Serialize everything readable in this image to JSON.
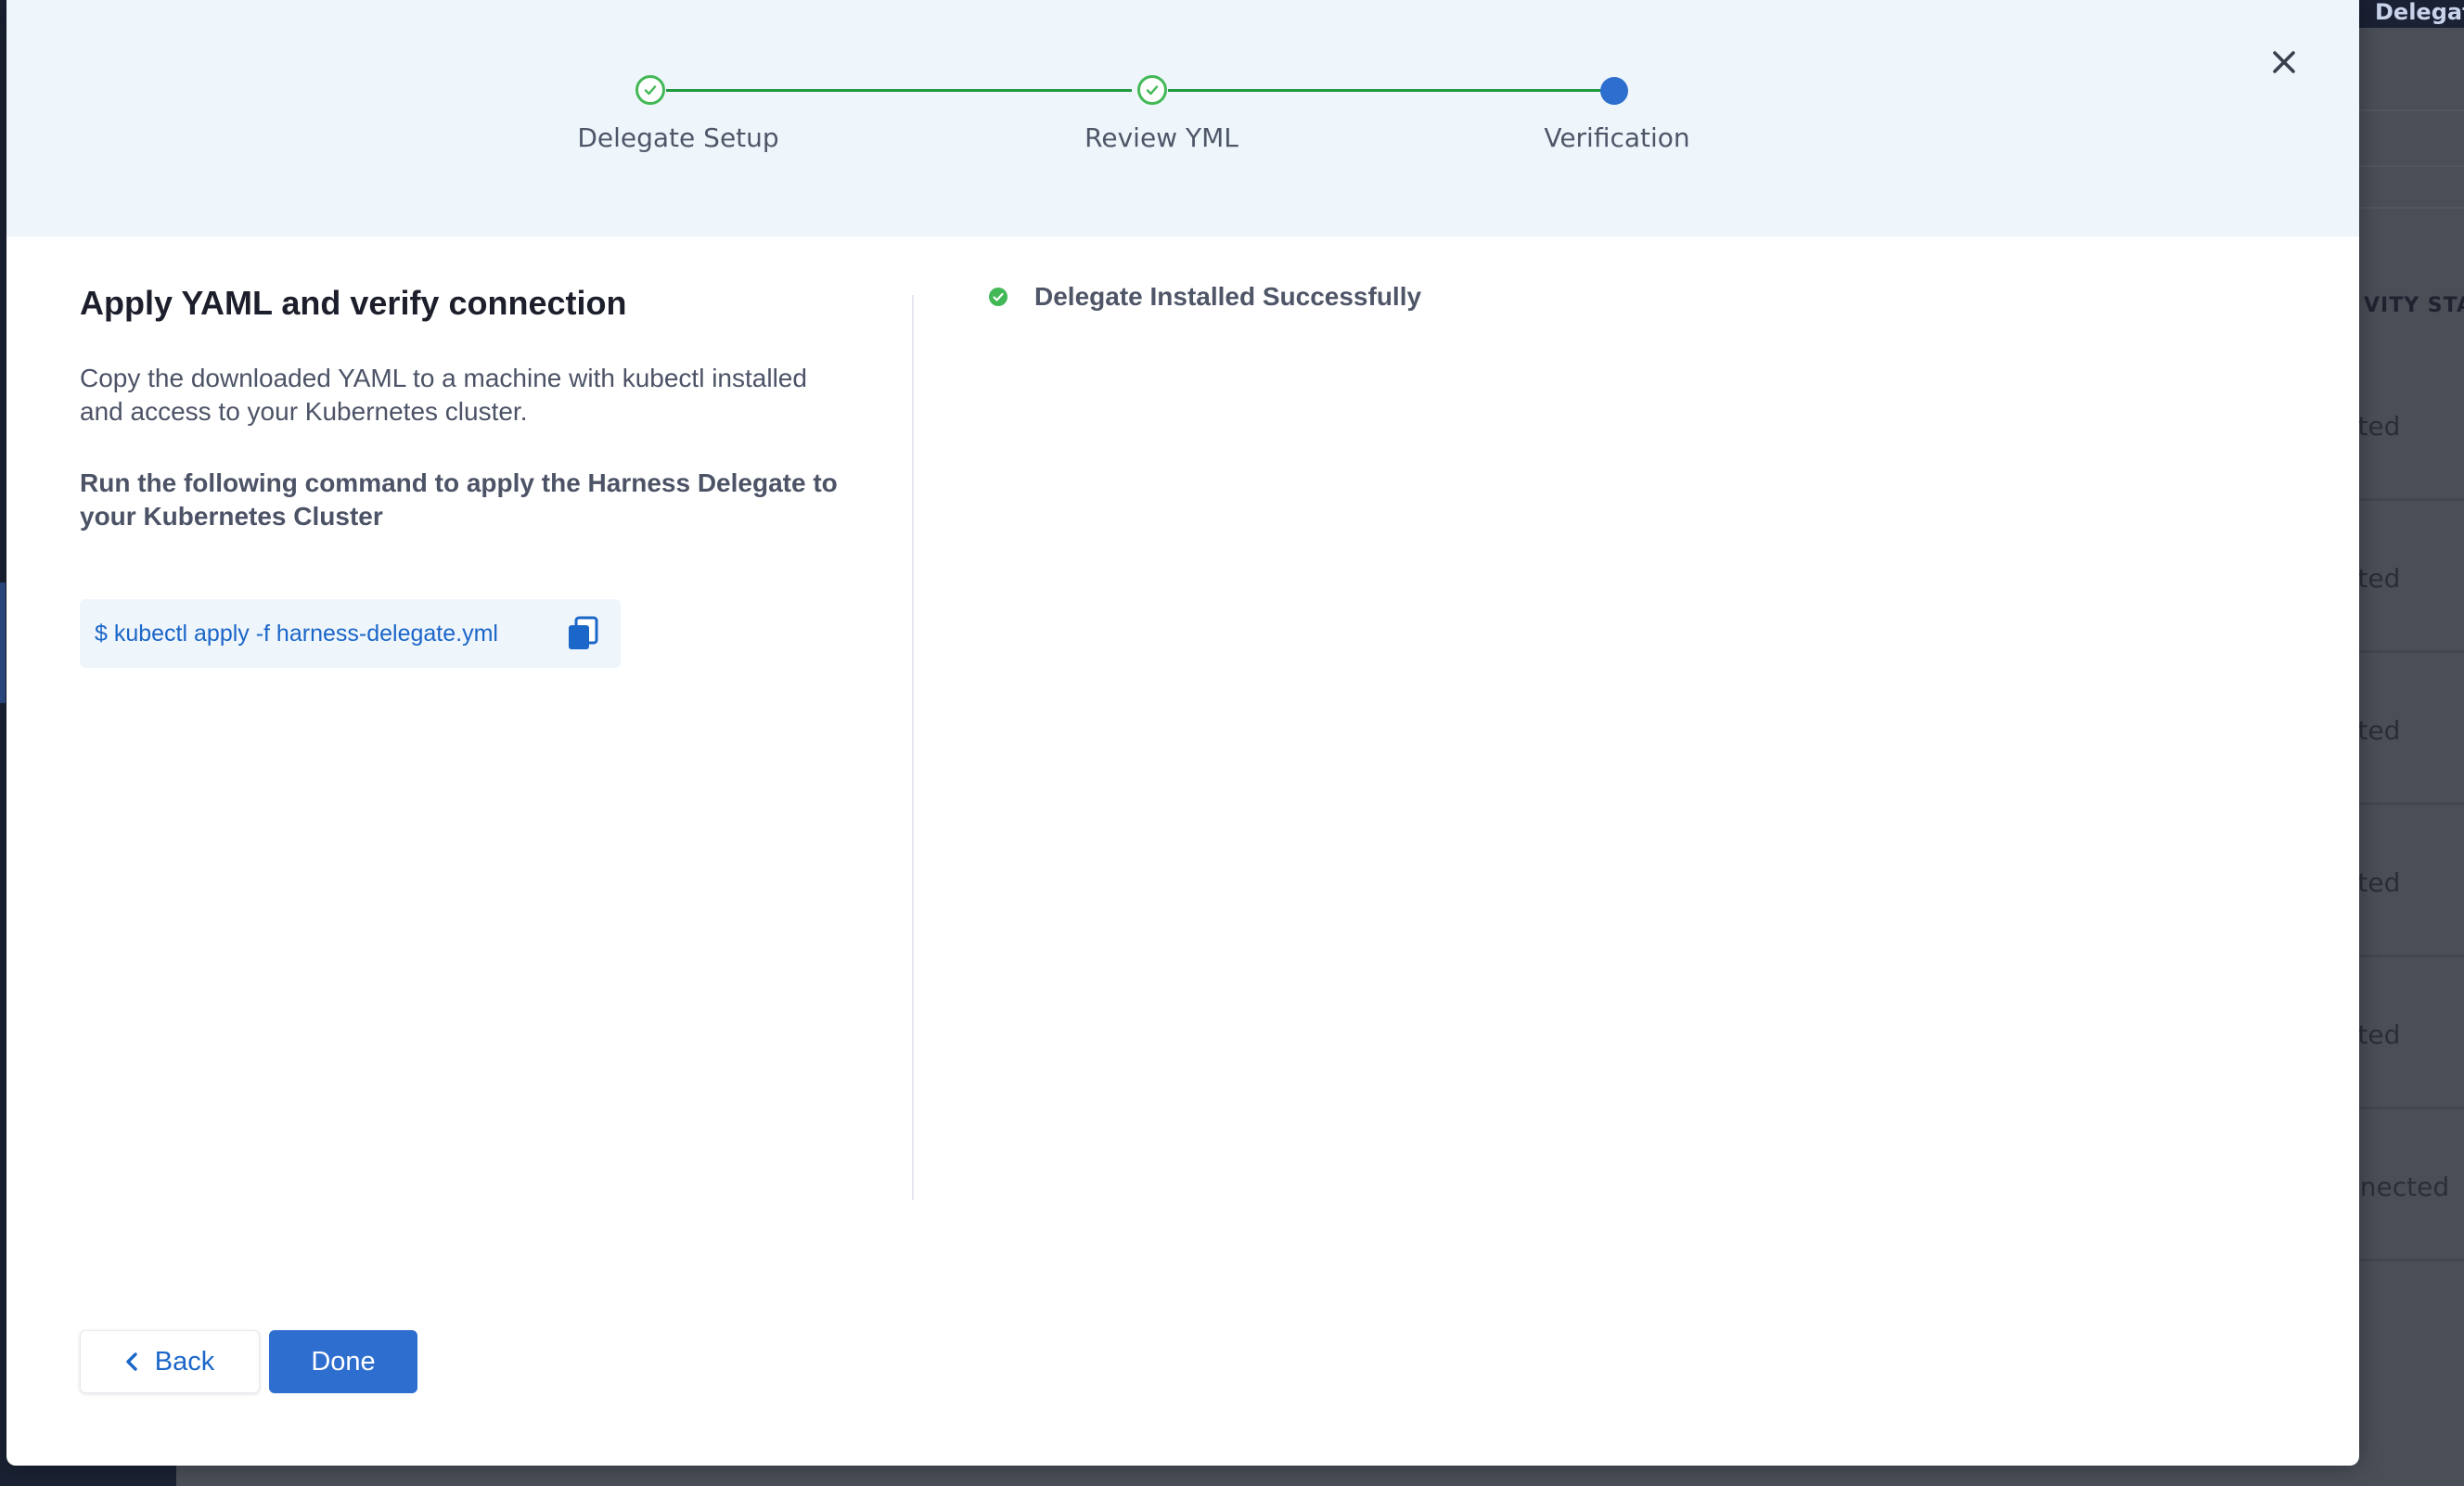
{
  "background": {
    "delegate_button": "Delegate",
    "column_header": "VITY STAT",
    "rows": [
      "cted",
      "cted",
      "cted",
      "cted",
      "cted",
      "nnected"
    ]
  },
  "stepper": {
    "steps": [
      {
        "label": "Delegate Setup",
        "state": "done"
      },
      {
        "label": "Review YML",
        "state": "done"
      },
      {
        "label": "Verification",
        "state": "current"
      }
    ]
  },
  "content": {
    "title": "Apply YAML and verify connection",
    "description": "Copy the downloaded YAML to a machine with kubectl installed and access to your Kubernetes cluster.",
    "command_heading": "Run the following command to apply the Harness Delegate to your Kubernetes Cluster",
    "command": "$ kubectl apply -f harness-delegate.yml",
    "status_text": "Delegate Installed Successfully"
  },
  "footer": {
    "back_label": "Back",
    "done_label": "Done"
  },
  "colors": {
    "accent": "#2e6ecf",
    "success": "#42b856",
    "header_bg": "#eef5fb"
  },
  "icons": [
    "close-icon",
    "check-icon",
    "copy-icon",
    "check-circle-icon",
    "chevron-left-icon"
  ]
}
